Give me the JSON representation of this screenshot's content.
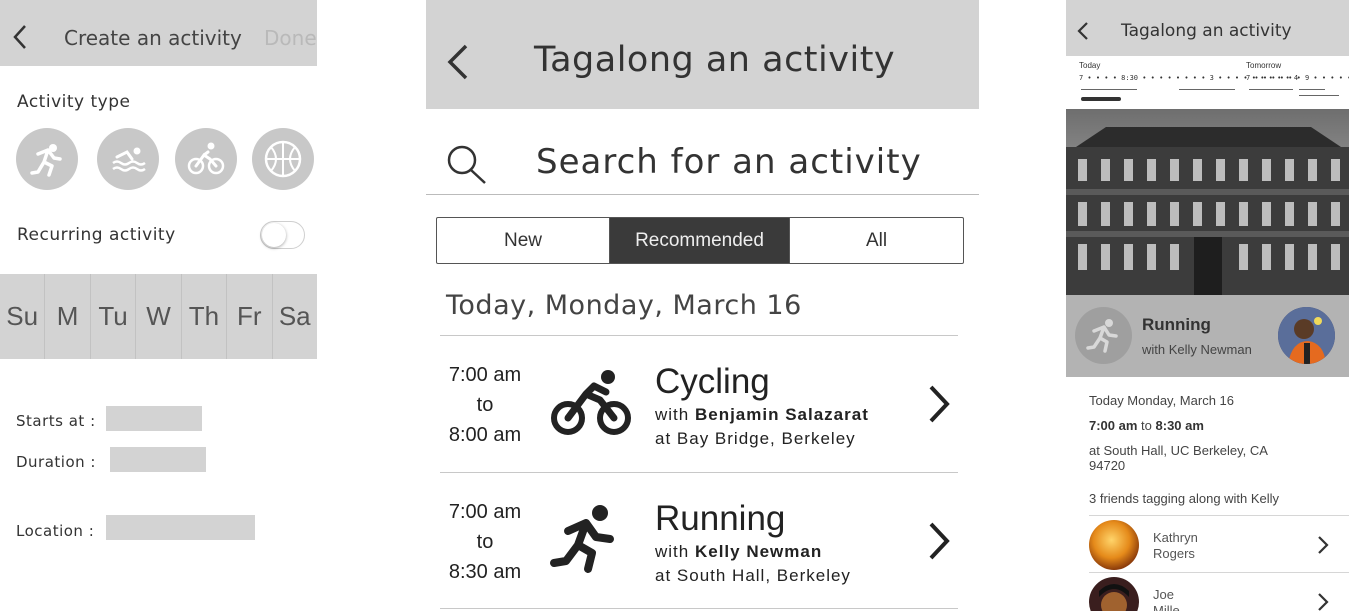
{
  "screen1": {
    "header": {
      "title": "Create an activity",
      "done_label": "Done"
    },
    "activity_type_label": "Activity type",
    "activity_icons": [
      "running-icon",
      "swimming-icon",
      "cycling-icon",
      "basketball-icon"
    ],
    "recurring_label": "Recurring activity",
    "recurring_on": false,
    "days": [
      "Su",
      "M",
      "Tu",
      "W",
      "Th",
      "Fr",
      "Sa"
    ],
    "fields": {
      "starts_at": "Starts at :",
      "duration": "Duration :",
      "location": "Location :"
    }
  },
  "screen2": {
    "header": {
      "title": "Tagalong an activity"
    },
    "search": {
      "placeholder": "Search for an activity"
    },
    "tabs": {
      "new": "New",
      "recommended": "Recommended",
      "all": "All",
      "selected": "Recommended"
    },
    "date_heading": "Today, Monday, March 16",
    "activities": [
      {
        "start": "7:00 am",
        "to": "to",
        "end": "8:00 am",
        "name": "Cycling",
        "with_prefix": "with",
        "person": "Benjamin Salazarat",
        "location": "at Bay Bridge, Berkeley",
        "icon": "cycling-icon"
      },
      {
        "start": "7:00 am",
        "to": "to",
        "end": "8:30 am",
        "name": "Running",
        "with_prefix": "with",
        "person": "Kelly Newman",
        "location": "at South Hall, Berkeley",
        "icon": "running-icon"
      }
    ]
  },
  "screen3": {
    "header": {
      "title": "Tagalong an activity"
    },
    "timeline": {
      "today_label": "Today",
      "today_ticks": "7 • • • • 8:30 • • • • • • • • 3 • • • • • • • • • 4",
      "tomorrow_label": "Tomorrow",
      "tomorrow_ticks": "7 • • • • • • 9 • • • • • • • • •"
    },
    "activity": {
      "name": "Running",
      "with_text": "with Kelly Newman"
    },
    "details": {
      "date": "Today Monday, March 16",
      "start": "7:00 am",
      "to": "to",
      "end": "8:30 am",
      "location_line1": "at South Hall, UC Berkeley, CA",
      "location_line2": "94720",
      "friends_summary": "3 friends tagging along with Kelly"
    },
    "friends": [
      {
        "first": "Kathryn",
        "last": "Rogers"
      },
      {
        "first": "Joe",
        "last": "Mille"
      }
    ]
  }
}
